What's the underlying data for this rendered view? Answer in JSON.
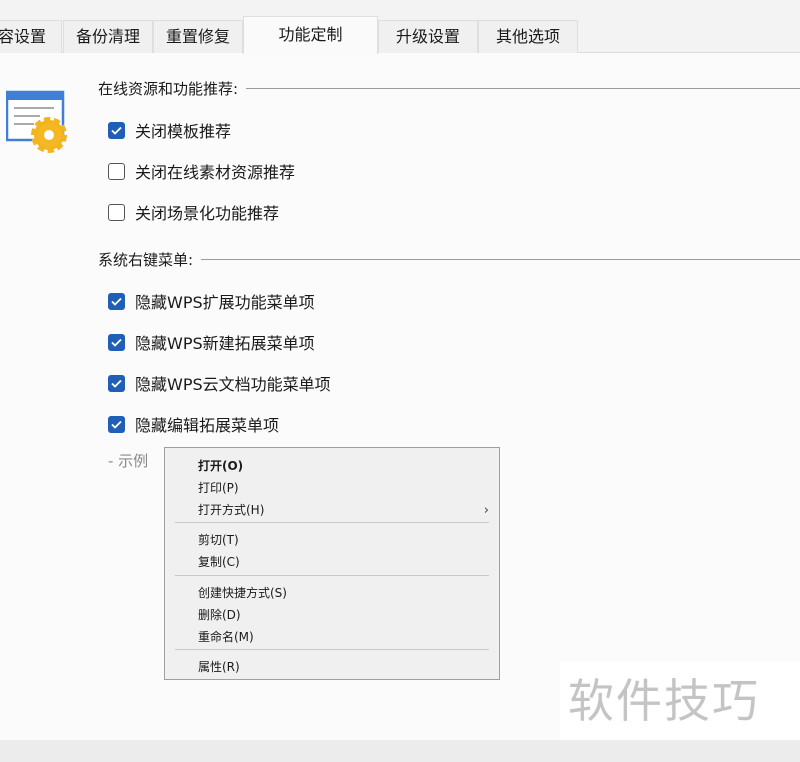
{
  "tabs": [
    {
      "label": "兼容设置",
      "active": false
    },
    {
      "label": "备份清理",
      "active": false
    },
    {
      "label": "重置修复",
      "active": false
    },
    {
      "label": "功能定制",
      "active": true
    },
    {
      "label": "升级设置",
      "active": false
    },
    {
      "label": "其他选项",
      "active": false
    }
  ],
  "sections": {
    "online": {
      "title": "在线资源和功能推荐:",
      "items": [
        {
          "label": "关闭模板推荐",
          "checked": true
        },
        {
          "label": "关闭在线素材资源推荐",
          "checked": false
        },
        {
          "label": "关闭场景化功能推荐",
          "checked": false
        }
      ]
    },
    "context": {
      "title": "系统右键菜单:",
      "items": [
        {
          "label": "隐藏WPS扩展功能菜单项",
          "checked": true
        },
        {
          "label": "隐藏WPS新建拓展菜单项",
          "checked": true
        },
        {
          "label": "隐藏WPS云文档功能菜单项",
          "checked": true
        },
        {
          "label": "隐藏编辑拓展菜单项",
          "checked": true
        }
      ]
    }
  },
  "example_label": "- 示例",
  "menu": [
    "打开(O)",
    "打印(P)",
    "打开方式(H)",
    "剪切(T)",
    "复制(C)",
    "创建快捷方式(S)",
    "删除(D)",
    "重命名(M)",
    "属性(R)"
  ],
  "watermark": "软件技巧",
  "colors": {
    "accent": "#1f5fb8"
  }
}
